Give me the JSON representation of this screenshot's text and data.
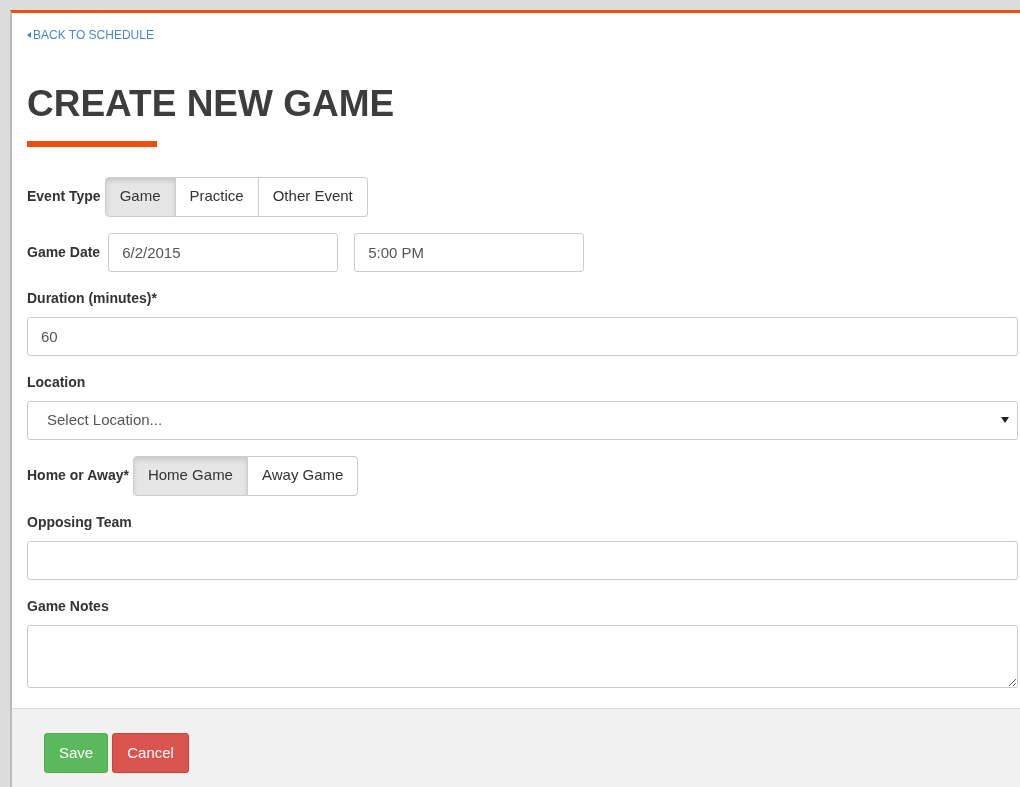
{
  "back_link": {
    "label": "BACK TO SCHEDULE"
  },
  "title": "CREATE NEW GAME",
  "event_type": {
    "label": "Event Type",
    "options": [
      {
        "label": "Game",
        "selected": true
      },
      {
        "label": "Practice",
        "selected": false
      },
      {
        "label": "Other Event",
        "selected": false
      }
    ]
  },
  "game_date": {
    "label": "Game Date",
    "date": "6/2/2015",
    "time": "5:00 PM"
  },
  "duration": {
    "label": "Duration (minutes)*",
    "value": "60"
  },
  "location": {
    "label": "Location",
    "placeholder": "Select Location..."
  },
  "home_or_away": {
    "label": "Home or Away*",
    "options": [
      {
        "label": "Home Game",
        "selected": true
      },
      {
        "label": "Away Game",
        "selected": false
      }
    ]
  },
  "opposing_team": {
    "label": "Opposing Team"
  },
  "game_notes": {
    "label": "Game Notes"
  },
  "buttons": [
    {
      "label": "Save",
      "kind": "success"
    },
    {
      "label": "Cancel",
      "kind": "danger"
    }
  ]
}
